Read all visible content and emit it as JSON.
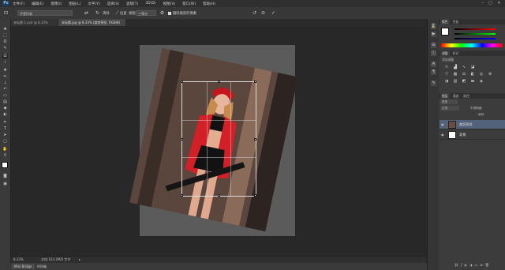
{
  "app": {
    "logo": "Ps"
  },
  "menu": [
    "文件(F)",
    "编辑(E)",
    "图像(I)",
    "图层(L)",
    "文字(Y)",
    "选择(S)",
    "滤镜(T)",
    "3D(D)",
    "视图(V)",
    "窗口(W)",
    "帮助(H)"
  ],
  "window_controls": {
    "minimize": "–",
    "maximize": "□",
    "close": "✕"
  },
  "options_bar": {
    "tool_icon": "crop-icon",
    "preset": "不受约束",
    "clear_label": "清除",
    "straighten_label": "拉直",
    "view_label": "视图:",
    "view_value": "三等分",
    "delete_pixels_label": "删除裁剪的像素"
  },
  "tabs": [
    {
      "label": "未标题-1.psd @ 8.33%(RGB/8)",
      "close": "×",
      "active": false
    },
    {
      "label": "未标题.jpg @ 8.33% (裁剪预览, RGB/8)",
      "close": "×",
      "active": true
    }
  ],
  "status": {
    "zoom": "8.33%",
    "doc_info": "文档:103.2M/0 字节"
  },
  "bottom_tabs": [
    "Mini Bridge",
    "时间轴"
  ],
  "panels": {
    "color_tabs": [
      "颜色",
      "色板"
    ],
    "adjust_tabs": [
      "调整",
      "样式"
    ],
    "adjust_title": "添加调整",
    "layers_tabs": [
      "图层",
      "通道",
      "路径"
    ],
    "kind_label": "类型",
    "blend_mode": "正常",
    "opacity_label": "不透明度:",
    "fill_label": "填充:"
  },
  "layers": [
    {
      "name": "裁剪预览",
      "selected": true
    },
    {
      "name": "背景",
      "selected": false
    }
  ]
}
